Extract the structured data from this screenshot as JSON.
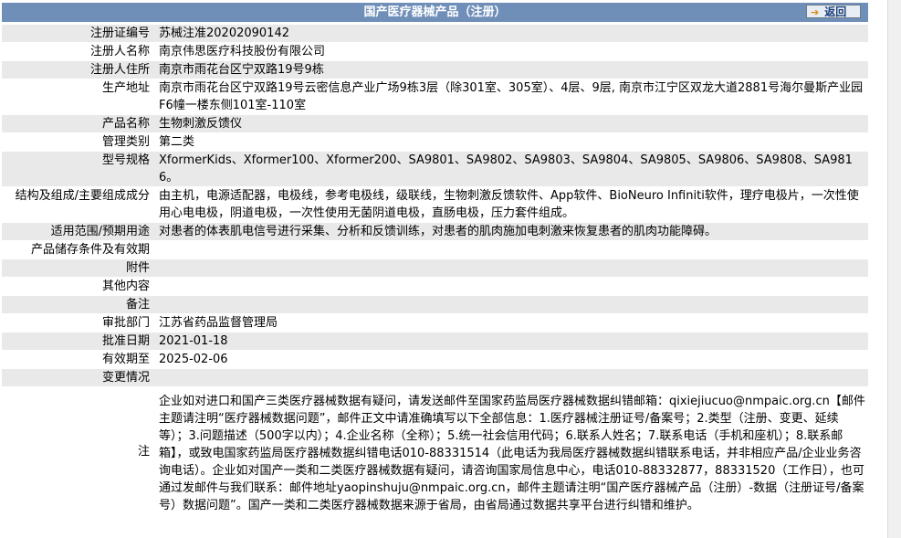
{
  "header": {
    "title": "国产医疗器械产品（注册）",
    "back_label": "返回",
    "back_icon": "arrow-right-icon"
  },
  "rows": [
    {
      "label": "注册证编号",
      "value": "苏械注准20202090142"
    },
    {
      "label": "注册人名称",
      "value": "南京伟思医疗科技股份有限公司"
    },
    {
      "label": "注册人住所",
      "value": "南京市雨花台区宁双路19号9栋"
    },
    {
      "label": "生产地址",
      "value": "南京市雨花台区宁双路19号云密信息产业广场9栋3层（除301室、305室）、4层、9层, 南京市江宁区双龙大道2881号海尔曼斯产业园F6幢一楼东侧101室-110室"
    },
    {
      "label": "产品名称",
      "value": "生物刺激反馈仪"
    },
    {
      "label": "管理类别",
      "value": "第二类"
    },
    {
      "label": "型号规格",
      "value": "XformerKids、Xformer100、Xformer200、SA9801、SA9802、SA9803、SA9804、SA9805、SA9806、SA9808、SA9816。"
    },
    {
      "label": "结构及组成/主要组成成分",
      "value": "由主机，电源适配器，电极线，参考电极线，级联线，生物刺激反馈软件、App软件、BioNeuro Infiniti软件，理疗电极片，一次性使用心电电极，阴道电极，一次性使用无菌阴道电极，直肠电极，压力套件组成。"
    },
    {
      "label": "适用范围/预期用途",
      "value": "对患者的体表肌电信号进行采集、分析和反馈训练，对患者的肌肉施加电刺激来恢复患者的肌肉功能障碍。"
    },
    {
      "label": "产品储存条件及有效期",
      "value": ""
    },
    {
      "label": "附件",
      "value": ""
    },
    {
      "label": "其他内容",
      "value": ""
    },
    {
      "label": "备注",
      "value": ""
    },
    {
      "label": "审批部门",
      "value": "江苏省药品监督管理局"
    },
    {
      "label": "批准日期",
      "value": "2021-01-18"
    },
    {
      "label": "有效期至",
      "value": "2025-02-06"
    },
    {
      "label": "变更情况",
      "value": ""
    }
  ],
  "note": {
    "label": "注",
    "text": "企业如对进口和国产三类医疗器械数据有疑问，请发送邮件至国家药监局医疗器械数据纠错邮箱：qixiejiucuo@nmpaic.org.cn【邮件主题请注明“医疗器械数据问题”，邮件正文中请准确填写以下全部信息：1.医疗器械注册证号/备案号；2.类型（注册、变更、延续等）；3.问题描述（500字以内）；4.企业名称（全称）；5.统一社会信用代码；6.联系人姓名；7.联系电话（手机和座机）；8.联系邮箱】，或致电国家药监局医疗器械数据纠错电话010-88331514（此电话为我局医疗器械数据纠错联系电话，并非相应产品/企业业务咨询电话）。企业如对国产一类和二类医疗器械数据有疑问，请咨询国家局信息中心，电话010-88332877，88331520（工作日），也可通过发邮件与我们联系：邮件地址yaopinshuju@nmpaic.org.cn，邮件主题请注明“国产医疗器械产品（注册）-数据（注册证号/备案号）数据问题”。国产一类和二类医疗器械数据来源于省局，由省局通过数据共享平台进行纠错和维护。"
  }
}
